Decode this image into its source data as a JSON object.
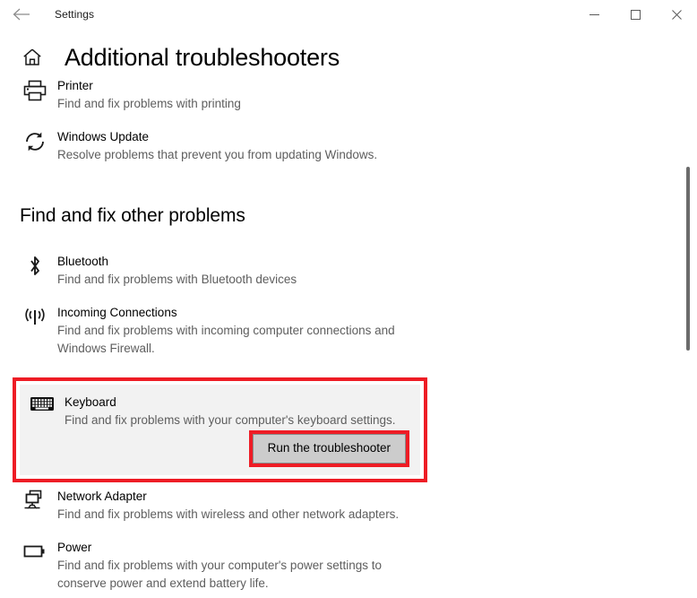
{
  "window": {
    "app_title": "Settings",
    "back_icon": "back-arrow-icon",
    "minimize_label": "Minimize",
    "maximize_label": "Maximize",
    "close_label": "Close"
  },
  "page": {
    "title": "Additional troubleshooters",
    "home_icon": "home-icon"
  },
  "section_heading": "Find and fix other problems",
  "colors": {
    "annotation_red": "#ee1c25",
    "selected_background": "#f2f2f2",
    "button_face": "#cccccc",
    "description_text": "#5e5e5e"
  },
  "top_items": [
    {
      "icon": "printer-icon",
      "name": "Printer",
      "description": "Find and fix problems with printing"
    },
    {
      "icon": "refresh-icon",
      "name": "Windows Update",
      "description": "Resolve problems that prevent you from updating Windows."
    }
  ],
  "other_items": [
    {
      "icon": "bluetooth-icon",
      "name": "Bluetooth",
      "description": "Find and fix problems with Bluetooth devices"
    },
    {
      "icon": "broadcast-icon",
      "name": "Incoming Connections",
      "description": "Find and fix problems with incoming computer connections and Windows Firewall."
    }
  ],
  "selected_item": {
    "icon": "keyboard-icon",
    "name": "Keyboard",
    "description": "Find and fix problems with your computer's keyboard settings.",
    "action_label": "Run the troubleshooter"
  },
  "bottom_items": [
    {
      "icon": "network-adapter-icon",
      "name": "Network Adapter",
      "description": "Find and fix problems with wireless and other network adapters."
    },
    {
      "icon": "battery-icon",
      "name": "Power",
      "description": "Find and fix problems with your computer's power settings to conserve power and extend battery life."
    }
  ]
}
